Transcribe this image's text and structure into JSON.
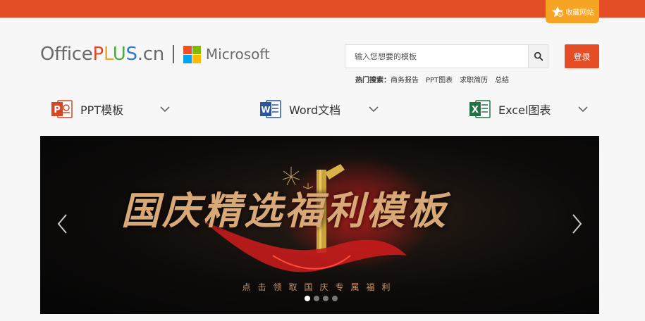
{
  "header": {
    "favorite_label": "收藏网站",
    "logo": {
      "office": "Office",
      "p": "P",
      "l": "L",
      "u": "U",
      "s": "S",
      "domain": ".cn",
      "partner": "Microsoft"
    },
    "search": {
      "placeholder": "输入您想要的模板"
    },
    "login_label": "登录",
    "hot_search": {
      "label": "热门搜索：",
      "items": [
        "商务报告",
        "PPT图表",
        "求职简历",
        "总结"
      ]
    }
  },
  "nav": {
    "items": [
      {
        "label": "PPT模板",
        "icon": "powerpoint-icon",
        "color": "#d24726"
      },
      {
        "label": "Word文档",
        "icon": "word-icon",
        "color": "#2b579a"
      },
      {
        "label": "Excel图表",
        "icon": "excel-icon",
        "color": "#217346"
      }
    ]
  },
  "banner": {
    "title": "国庆精选福利模板",
    "subtitle": "点击领取国庆专属福利",
    "slide_count": 4,
    "active_slide": 1
  },
  "colors": {
    "brand": "#e54d26",
    "favorite": "#f7a323"
  }
}
